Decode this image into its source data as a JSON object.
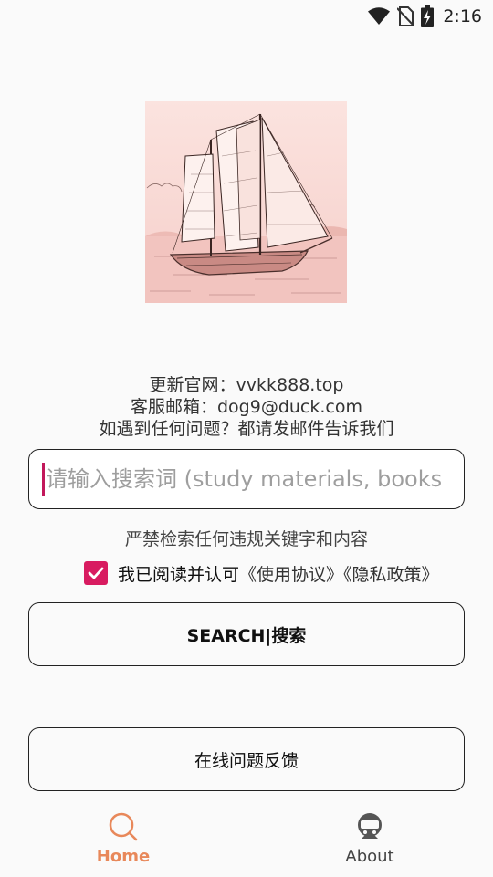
{
  "status_bar": {
    "time": "2:16",
    "icons": [
      "wifi-icon",
      "no-sim-icon",
      "battery-charging-icon"
    ]
  },
  "hero": {
    "image": "sailing-ship-sketch"
  },
  "info": {
    "line1": "更新官网：vvkk888.top",
    "line2": "客服邮箱：dog9@duck.com",
    "line3": "如遇到任何问题？都请发邮件告诉我们"
  },
  "search": {
    "placeholder": "请输入搜索词 (study materials, books"
  },
  "warning": "严禁检索任何违规关键字和内容",
  "agreement": {
    "checked": true,
    "text": "我已阅读并认可",
    "links": "《使用协议》《隐私政策》"
  },
  "buttons": {
    "search": "SEARCH|搜索",
    "feedback": "在线问题反馈"
  },
  "bottom_nav": {
    "items": [
      {
        "label": "Home",
        "icon": "search-icon",
        "active": true
      },
      {
        "label": "About",
        "icon": "about-icon",
        "active": false
      }
    ]
  },
  "colors": {
    "accent": "#d81b60",
    "nav_active": "#e8885a",
    "hero_bg": "#f8d8d4"
  }
}
